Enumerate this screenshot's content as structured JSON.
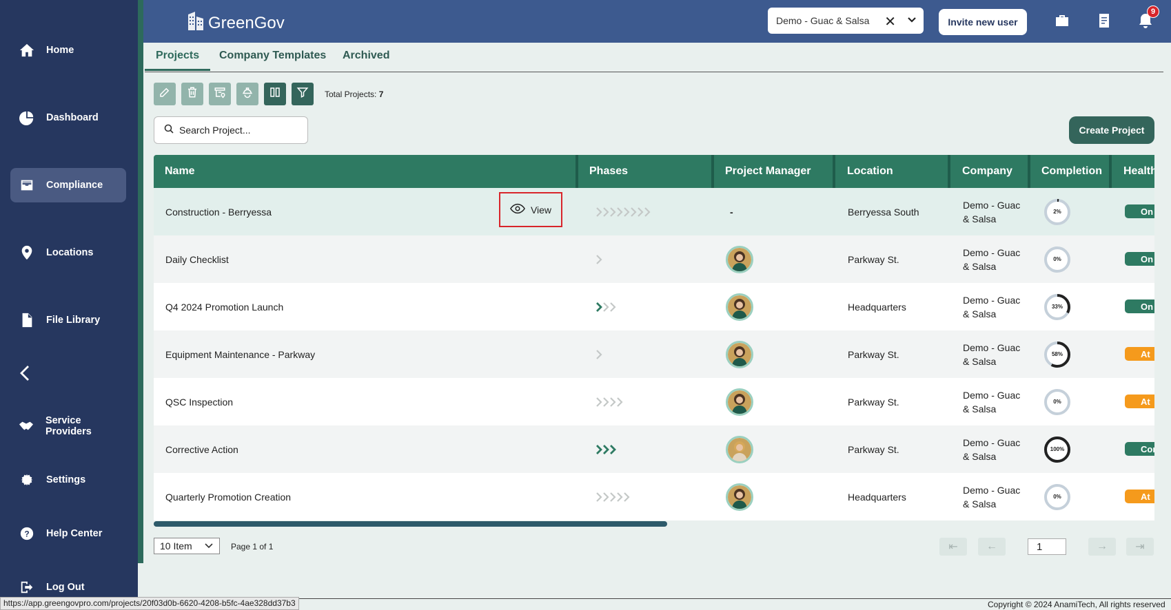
{
  "app": {
    "name": "GreenGov"
  },
  "sidebar": {
    "items": [
      {
        "label": "Home",
        "icon": "home-icon"
      },
      {
        "label": "Dashboard",
        "icon": "pie-chart-icon"
      },
      {
        "label": "Compliance",
        "icon": "inbox-icon",
        "active": true
      },
      {
        "label": "Locations",
        "icon": "map-pin-icon"
      },
      {
        "label": "File Library",
        "icon": "file-icon"
      },
      {
        "label": "Service Providers",
        "icon": "handshake-icon"
      },
      {
        "label": "Settings",
        "icon": "gear-icon"
      },
      {
        "label": "Help Center",
        "icon": "help-icon"
      },
      {
        "label": "Log Out",
        "icon": "logout-icon"
      }
    ]
  },
  "header": {
    "company_select": "Demo - Guac & Salsa",
    "invite_label": "Invite new user",
    "notification_count": "9"
  },
  "tabs": [
    {
      "label": "Projects",
      "active": true
    },
    {
      "label": "Company Templates"
    },
    {
      "label": "Archived"
    }
  ],
  "toolbar": {
    "total_label": "Total Projects:",
    "total_value": "7"
  },
  "search": {
    "placeholder": "Search Project..."
  },
  "create_label": "Create Project",
  "table": {
    "columns": [
      "Name",
      "Phases",
      "Project Manager",
      "Location",
      "Company",
      "Completion",
      "Health"
    ],
    "view_label": "View",
    "rows": [
      {
        "name": "Construction - Berryessa",
        "phases_done": 0,
        "phases_total": 8,
        "manager": "-",
        "location": "Berryessa South",
        "company_1": "Demo - Guac",
        "company_2": "& Salsa",
        "completion": 2,
        "completion_label": "2%",
        "health": "On",
        "health_color": "#2e7a62"
      },
      {
        "name": "Daily Checklist",
        "phases_done": 0,
        "phases_total": 1,
        "manager": "avatar",
        "location": "Parkway St.",
        "company_1": "Demo - Guac",
        "company_2": "& Salsa",
        "completion": 0,
        "completion_label": "0%",
        "health": "On",
        "health_color": "#2e7a62"
      },
      {
        "name": "Q4 2024 Promotion Launch",
        "phases_done": 1,
        "phases_total": 3,
        "manager": "avatar",
        "location": "Headquarters",
        "company_1": "Demo - Guac",
        "company_2": "& Salsa",
        "completion": 33,
        "completion_label": "33%",
        "health": "On",
        "health_color": "#2e7a62"
      },
      {
        "name": "Equipment Maintenance - Parkway",
        "phases_done": 0,
        "phases_total": 1,
        "manager": "avatar",
        "location": "Parkway St.",
        "company_1": "Demo - Guac",
        "company_2": "& Salsa",
        "completion": 58,
        "completion_label": "58%",
        "health": "At",
        "health_color": "#f59a1c"
      },
      {
        "name": "QSC Inspection",
        "phases_done": 0,
        "phases_total": 4,
        "manager": "avatar",
        "location": "Parkway St.",
        "company_1": "Demo - Guac",
        "company_2": "& Salsa",
        "completion": 0,
        "completion_label": "0%",
        "health": "At",
        "health_color": "#f59a1c"
      },
      {
        "name": "Corrective Action",
        "phases_done": 3,
        "phases_total": 3,
        "manager": "avatar",
        "location": "Parkway St.",
        "company_1": "Demo - Guac",
        "company_2": "& Salsa",
        "completion": 100,
        "completion_label": "100%",
        "health": "Cor",
        "health_color": "#2e7a62"
      },
      {
        "name": "Quarterly Promotion Creation",
        "phases_done": 0,
        "phases_total": 5,
        "manager": "avatar",
        "location": "Headquarters",
        "company_1": "Demo - Guac",
        "company_2": "& Salsa",
        "completion": 0,
        "completion_label": "0%",
        "health": "At",
        "health_color": "#f59a1c"
      }
    ]
  },
  "pagination": {
    "per_page": "10 Item",
    "page_info": "Page 1 of 1",
    "current_page": "1"
  },
  "footer": {
    "copyright": "Copyright © 2024 AnamiTech, All rights reserved",
    "status_url": "https://app.greengovpro.com/projects/20f03d0b-6620-4208-b5fc-4ae328dd37b3"
  },
  "colors": {
    "sidebar": "#26375f",
    "header": "#3d5a8f",
    "table_header": "#2e7a62",
    "primary_button": "#34655b",
    "warning": "#f59a1c"
  }
}
